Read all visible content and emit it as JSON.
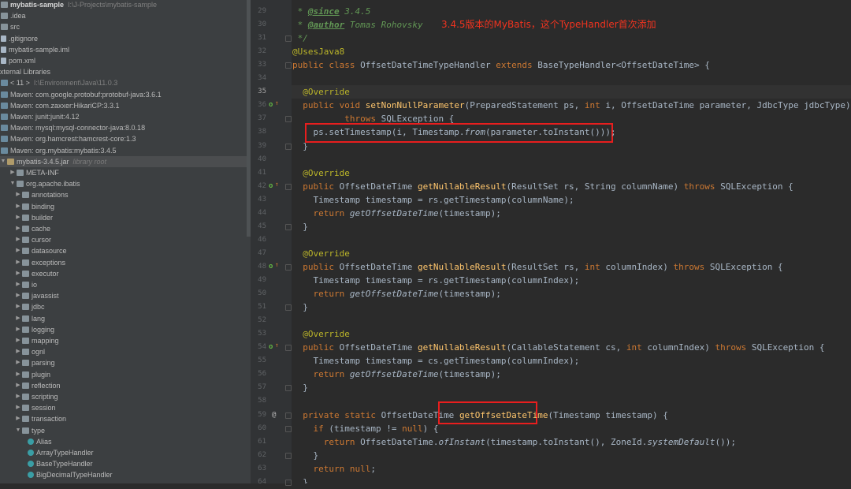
{
  "tree": {
    "rows": [
      {
        "text": "mybatis-sample",
        "extra": "I:\\J-Projects\\mybatis-sample",
        "icon": "folder",
        "arrow": "",
        "indent": 0,
        "bold": true
      },
      {
        "text": ".idea",
        "icon": "folder",
        "arrow": "",
        "indent": 0
      },
      {
        "text": "src",
        "icon": "folder",
        "arrow": "",
        "indent": 0
      },
      {
        "text": ".gitignore",
        "icon": "file",
        "arrow": "",
        "indent": 0
      },
      {
        "text": "mybatis-sample.iml",
        "icon": "file",
        "arrow": "",
        "indent": 0
      },
      {
        "text": "pom.xml",
        "icon": "file",
        "arrow": "",
        "indent": 0
      },
      {
        "text": "xternal Libraries",
        "icon": "",
        "arrow": "",
        "indent": 0
      },
      {
        "text": "< 11 >",
        "extra": "I:\\Environment\\Java\\11.0.3",
        "icon": "lib",
        "arrow": "",
        "indent": 0
      },
      {
        "text": "Maven: com.google.protobuf:protobuf-java:3.6.1",
        "icon": "lib",
        "arrow": "",
        "indent": 0
      },
      {
        "text": "Maven: com.zaxxer:HikariCP:3.3.1",
        "icon": "lib",
        "arrow": "",
        "indent": 0
      },
      {
        "text": "Maven: junit:junit:4.12",
        "icon": "lib",
        "arrow": "",
        "indent": 0
      },
      {
        "text": "Maven: mysql:mysql-connector-java:8.0.18",
        "icon": "lib",
        "arrow": "",
        "indent": 0
      },
      {
        "text": "Maven: org.hamcrest:hamcrest-core:1.3",
        "icon": "lib",
        "arrow": "",
        "indent": 0
      },
      {
        "text": "Maven: org.mybatis:mybatis:3.4.5",
        "icon": "lib",
        "arrow": "",
        "indent": 0
      },
      {
        "text": "mybatis-3.4.5.jar",
        "extra": "library root",
        "icon": "jar",
        "arrow": "▼",
        "indent": 0,
        "selected": true
      },
      {
        "text": "META-INF",
        "icon": "folder",
        "arrow": "▶",
        "indent": 1
      },
      {
        "text": "org.apache.ibatis",
        "icon": "pkg",
        "arrow": "▼",
        "indent": 1
      },
      {
        "text": "annotations",
        "icon": "pkg",
        "arrow": "▶",
        "indent": 2
      },
      {
        "text": "binding",
        "icon": "pkg",
        "arrow": "▶",
        "indent": 2
      },
      {
        "text": "builder",
        "icon": "pkg",
        "arrow": "▶",
        "indent": 2
      },
      {
        "text": "cache",
        "icon": "pkg",
        "arrow": "▶",
        "indent": 2
      },
      {
        "text": "cursor",
        "icon": "pkg",
        "arrow": "▶",
        "indent": 2
      },
      {
        "text": "datasource",
        "icon": "pkg",
        "arrow": "▶",
        "indent": 2
      },
      {
        "text": "exceptions",
        "icon": "pkg",
        "arrow": "▶",
        "indent": 2
      },
      {
        "text": "executor",
        "icon": "pkg",
        "arrow": "▶",
        "indent": 2
      },
      {
        "text": "io",
        "icon": "pkg",
        "arrow": "▶",
        "indent": 2
      },
      {
        "text": "javassist",
        "icon": "pkg",
        "arrow": "▶",
        "indent": 2
      },
      {
        "text": "jdbc",
        "icon": "pkg",
        "arrow": "▶",
        "indent": 2
      },
      {
        "text": "lang",
        "icon": "pkg",
        "arrow": "▶",
        "indent": 2
      },
      {
        "text": "logging",
        "icon": "pkg",
        "arrow": "▶",
        "indent": 2
      },
      {
        "text": "mapping",
        "icon": "pkg",
        "arrow": "▶",
        "indent": 2
      },
      {
        "text": "ognl",
        "icon": "pkg",
        "arrow": "▶",
        "indent": 2
      },
      {
        "text": "parsing",
        "icon": "pkg",
        "arrow": "▶",
        "indent": 2
      },
      {
        "text": "plugin",
        "icon": "pkg",
        "arrow": "▶",
        "indent": 2
      },
      {
        "text": "reflection",
        "icon": "pkg",
        "arrow": "▶",
        "indent": 2
      },
      {
        "text": "scripting",
        "icon": "pkg",
        "arrow": "▶",
        "indent": 2
      },
      {
        "text": "session",
        "icon": "pkg",
        "arrow": "▶",
        "indent": 2
      },
      {
        "text": "transaction",
        "icon": "pkg",
        "arrow": "▶",
        "indent": 2
      },
      {
        "text": "type",
        "icon": "pkg",
        "arrow": "▼",
        "indent": 2
      },
      {
        "text": "Alias",
        "icon": "cls",
        "arrow": "",
        "indent": 3
      },
      {
        "text": "ArrayTypeHandler",
        "icon": "cls",
        "arrow": "",
        "indent": 3
      },
      {
        "text": "BaseTypeHandler",
        "icon": "cls",
        "arrow": "",
        "indent": 3
      },
      {
        "text": "BigDecimalTypeHandler",
        "icon": "cls",
        "arrow": "",
        "indent": 3
      }
    ]
  },
  "editor": {
    "annotation_note": "3.4.5版本的MyBatis，这个TypeHandler首次添加",
    "lines": [
      {
        "n": "29",
        "tokens": [
          [
            "doc",
            " * "
          ],
          [
            "doctag",
            "@since"
          ],
          [
            "doc",
            " 3.4.5"
          ]
        ]
      },
      {
        "n": "30",
        "tokens": [
          [
            "doc",
            " * "
          ],
          [
            "doctag",
            "@author"
          ],
          [
            "doc",
            " Tomas Rohovsky"
          ]
        ]
      },
      {
        "n": "31",
        "tokens": [
          [
            "doc",
            " */"
          ]
        ]
      },
      {
        "n": "32",
        "tokens": [
          [
            "ann",
            "@UsesJava8"
          ]
        ]
      },
      {
        "n": "33",
        "tokens": [
          [
            "kw",
            "public class "
          ],
          [
            "plain",
            "OffsetDateTimeTypeHandler "
          ],
          [
            "kw",
            "extends "
          ],
          [
            "plain",
            "BaseTypeHandler<OffsetDateTime> {"
          ]
        ]
      },
      {
        "n": "34",
        "tokens": []
      },
      {
        "n": "35",
        "current": true,
        "tokens": [
          [
            "plain",
            "  "
          ],
          [
            "ann",
            "@Override"
          ]
        ]
      },
      {
        "n": "36",
        "marker": "override",
        "tokens": [
          [
            "plain",
            "  "
          ],
          [
            "kw",
            "public void "
          ],
          [
            "fn",
            "setNonNullParameter"
          ],
          [
            "plain",
            "(PreparedStatement ps, "
          ],
          [
            "kw",
            "int "
          ],
          [
            "plain",
            "i, OffsetDateTime parameter, JdbcType jdbcType)"
          ]
        ]
      },
      {
        "n": "37",
        "tokens": [
          [
            "plain",
            "          "
          ],
          [
            "kw",
            "throws "
          ],
          [
            "plain",
            "SQLException {"
          ]
        ]
      },
      {
        "n": "38",
        "tokens": [
          [
            "plain",
            "    ps.setTimestamp(i, Timestamp."
          ],
          [
            "it",
            "from"
          ],
          [
            "plain",
            "(parameter.toInstant()));"
          ]
        ]
      },
      {
        "n": "39",
        "tokens": [
          [
            "plain",
            "  }"
          ]
        ]
      },
      {
        "n": "40",
        "tokens": []
      },
      {
        "n": "41",
        "tokens": [
          [
            "plain",
            "  "
          ],
          [
            "ann",
            "@Override"
          ]
        ]
      },
      {
        "n": "42",
        "marker": "override",
        "tokens": [
          [
            "plain",
            "  "
          ],
          [
            "kw",
            "public "
          ],
          [
            "plain",
            "OffsetDateTime "
          ],
          [
            "fn",
            "getNullableResult"
          ],
          [
            "plain",
            "(ResultSet rs, String columnName) "
          ],
          [
            "kw",
            "throws "
          ],
          [
            "plain",
            "SQLException {"
          ]
        ]
      },
      {
        "n": "43",
        "tokens": [
          [
            "plain",
            "    Timestamp timestamp = rs.getTimestamp(columnName);"
          ]
        ]
      },
      {
        "n": "44",
        "tokens": [
          [
            "plain",
            "    "
          ],
          [
            "kw",
            "return "
          ],
          [
            "it",
            "getOffsetDateTime"
          ],
          [
            "plain",
            "(timestamp);"
          ]
        ]
      },
      {
        "n": "45",
        "tokens": [
          [
            "plain",
            "  }"
          ]
        ]
      },
      {
        "n": "46",
        "tokens": []
      },
      {
        "n": "47",
        "tokens": [
          [
            "plain",
            "  "
          ],
          [
            "ann",
            "@Override"
          ]
        ]
      },
      {
        "n": "48",
        "marker": "override",
        "tokens": [
          [
            "plain",
            "  "
          ],
          [
            "kw",
            "public "
          ],
          [
            "plain",
            "OffsetDateTime "
          ],
          [
            "fn",
            "getNullableResult"
          ],
          [
            "plain",
            "(ResultSet rs, "
          ],
          [
            "kw",
            "int "
          ],
          [
            "plain",
            "columnIndex) "
          ],
          [
            "kw",
            "throws "
          ],
          [
            "plain",
            "SQLException {"
          ]
        ]
      },
      {
        "n": "49",
        "tokens": [
          [
            "plain",
            "    Timestamp timestamp = rs.getTimestamp(columnIndex);"
          ]
        ]
      },
      {
        "n": "50",
        "tokens": [
          [
            "plain",
            "    "
          ],
          [
            "kw",
            "return "
          ],
          [
            "it",
            "getOffsetDateTime"
          ],
          [
            "plain",
            "(timestamp);"
          ]
        ]
      },
      {
        "n": "51",
        "tokens": [
          [
            "plain",
            "  }"
          ]
        ]
      },
      {
        "n": "52",
        "tokens": []
      },
      {
        "n": "53",
        "tokens": [
          [
            "plain",
            "  "
          ],
          [
            "ann",
            "@Override"
          ]
        ]
      },
      {
        "n": "54",
        "marker": "override",
        "tokens": [
          [
            "plain",
            "  "
          ],
          [
            "kw",
            "public "
          ],
          [
            "plain",
            "OffsetDateTime "
          ],
          [
            "fn",
            "getNullableResult"
          ],
          [
            "plain",
            "(CallableStatement cs, "
          ],
          [
            "kw",
            "int "
          ],
          [
            "plain",
            "columnIndex) "
          ],
          [
            "kw",
            "throws "
          ],
          [
            "plain",
            "SQLException {"
          ]
        ]
      },
      {
        "n": "55",
        "tokens": [
          [
            "plain",
            "    Timestamp timestamp = cs.getTimestamp(columnIndex);"
          ]
        ]
      },
      {
        "n": "56",
        "tokens": [
          [
            "plain",
            "    "
          ],
          [
            "kw",
            "return "
          ],
          [
            "it",
            "getOffsetDateTime"
          ],
          [
            "plain",
            "(timestamp);"
          ]
        ]
      },
      {
        "n": "57",
        "tokens": [
          [
            "plain",
            "  }"
          ]
        ]
      },
      {
        "n": "58",
        "tokens": []
      },
      {
        "n": "59",
        "marker": "at",
        "tokens": [
          [
            "plain",
            "  "
          ],
          [
            "kw",
            "private static "
          ],
          [
            "plain",
            "OffsetDateTime "
          ],
          [
            "fn",
            "getOffsetDateTime"
          ],
          [
            "plain",
            "(Timestamp timestamp) {"
          ]
        ]
      },
      {
        "n": "60",
        "tokens": [
          [
            "plain",
            "    "
          ],
          [
            "kw",
            "if "
          ],
          [
            "plain",
            "(timestamp != "
          ],
          [
            "kw",
            "null"
          ],
          [
            "plain",
            ") {"
          ]
        ]
      },
      {
        "n": "61",
        "tokens": [
          [
            "plain",
            "      "
          ],
          [
            "kw",
            "return "
          ],
          [
            "plain",
            "OffsetDateTime."
          ],
          [
            "it",
            "ofInstant"
          ],
          [
            "plain",
            "(timestamp.toInstant(), ZoneId."
          ],
          [
            "it",
            "systemDefault"
          ],
          [
            "plain",
            "());"
          ]
        ]
      },
      {
        "n": "62",
        "tokens": [
          [
            "plain",
            "    }"
          ]
        ]
      },
      {
        "n": "63",
        "tokens": [
          [
            "plain",
            "    "
          ],
          [
            "kw",
            "return null"
          ],
          [
            "plain",
            ";"
          ]
        ]
      },
      {
        "n": "64",
        "tokens": [
          [
            "plain",
            "  }"
          ]
        ]
      }
    ]
  }
}
